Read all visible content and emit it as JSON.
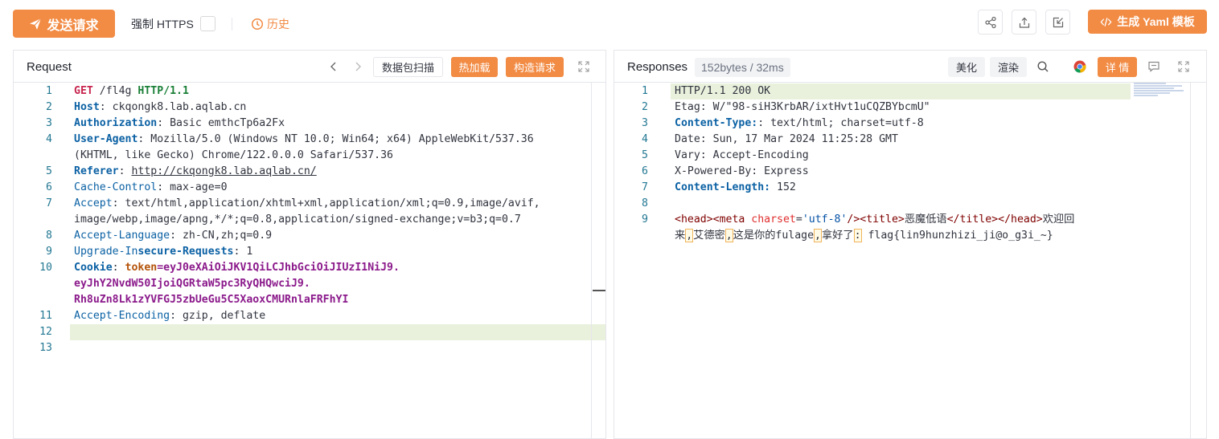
{
  "toolbar": {
    "send_label": "发送请求",
    "force_https_label": "强制 HTTPS",
    "force_https_checked": false,
    "history_label": "历史",
    "generate_label": "生成 Yaml 模板",
    "accent_color": "#f28b44"
  },
  "request": {
    "title": "Request",
    "buttons": {
      "scan": "数据包扫描",
      "hot_load": "热加载",
      "build": "构造请求"
    },
    "lines": [
      {
        "n": "1",
        "parts": [
          [
            "kw-method",
            "GET"
          ],
          [
            "kw-path",
            " /fl4g "
          ],
          [
            "kw-proto",
            "HTTP/1.1"
          ]
        ]
      },
      {
        "n": "2",
        "parts": [
          [
            "kw-key",
            "Host"
          ],
          [
            "",
            ": ckqongk8.lab.aqlab.cn"
          ]
        ]
      },
      {
        "n": "3",
        "parts": [
          [
            "kw-key",
            "Authorization"
          ],
          [
            "",
            ": Basic emthcTp6a2Fx"
          ]
        ]
      },
      {
        "n": "4",
        "parts": [
          [
            "kw-key",
            "User-Agent"
          ],
          [
            "",
            ": Mozilla/5.0 (Windows NT 10.0; Win64; x64) AppleWebKit/537.36"
          ]
        ]
      },
      {
        "n": "",
        "parts": [
          [
            "",
            "(KHTML, like Gecko) Chrome/122.0.0.0 Safari/537.36"
          ]
        ]
      },
      {
        "n": "5",
        "parts": [
          [
            "kw-key",
            "Referer"
          ],
          [
            "",
            ": "
          ],
          [
            "kw-url",
            "http://ckqongk8.lab.aqlab.cn/"
          ]
        ]
      },
      {
        "n": "6",
        "parts": [
          [
            "kw-key2",
            "Cache-Control"
          ],
          [
            "",
            ": max-age=0"
          ]
        ]
      },
      {
        "n": "7",
        "parts": [
          [
            "kw-key2",
            "Accept"
          ],
          [
            "",
            ": text/html,application/xhtml+xml,application/xml;q=0.9,image/avif,"
          ]
        ]
      },
      {
        "n": "",
        "parts": [
          [
            "",
            "image/webp,image/apng,*/*;q=0.8,application/signed-exchange;v=b3;q=0.7"
          ]
        ]
      },
      {
        "n": "8",
        "parts": [
          [
            "kw-key2",
            "Accept-Language"
          ],
          [
            "",
            ": zh-CN,zh;q=0.9"
          ]
        ]
      },
      {
        "n": "9",
        "parts": [
          [
            "kw-key2",
            "Upgrade-In"
          ],
          [
            "kw-key",
            "secure-Requests"
          ],
          [
            "",
            ": 1"
          ]
        ]
      },
      {
        "n": "10",
        "parts": [
          [
            "kw-key",
            "Cookie"
          ],
          [
            "",
            ": "
          ],
          [
            "kw-ck",
            "token"
          ],
          [
            "kw-cookie",
            "=eyJ0eXAiOiJKV1QiLCJhbGciOiJIUzI1NiJ9."
          ]
        ]
      },
      {
        "n": "",
        "parts": [
          [
            "kw-cookie",
            "eyJhY2NvdW50IjoiQGRtaW5pc3RyQHQwciJ9."
          ]
        ]
      },
      {
        "n": "",
        "parts": [
          [
            "kw-cookie",
            "Rh8uZn8Lk1zYVFGJ5zbUeGu5C5XaoxCMURnlaFRFhYI"
          ]
        ]
      },
      {
        "n": "11",
        "parts": [
          [
            "kw-key2",
            "Accept-Encoding"
          ],
          [
            "",
            ": gzip, deflate"
          ]
        ]
      },
      {
        "n": "12",
        "parts": [
          [
            "",
            ""
          ]
        ]
      },
      {
        "n": "13",
        "parts": [
          [
            "",
            ""
          ]
        ]
      }
    ]
  },
  "response": {
    "title": "Responses",
    "size_info": "152bytes / 32ms",
    "buttons": {
      "beautify": "美化",
      "render": "渲染",
      "details": "详 情"
    },
    "lines": [
      {
        "n": "1",
        "parts": [
          [
            "",
            "HTTP/1.1 200 OK"
          ]
        ]
      },
      {
        "n": "2",
        "parts": [
          [
            "",
            "Etag: W/\"98-siH3KrbAR/ixtHvt1uCQZBYbcmU\""
          ]
        ]
      },
      {
        "n": "3",
        "parts": [
          [
            "kw-key",
            "Content-Type:"
          ],
          [
            "",
            ": text/html; charset=utf-8"
          ]
        ]
      },
      {
        "n": "4",
        "parts": [
          [
            "",
            "Date: Sun, 17 Mar 2024 11:25:28 GMT"
          ]
        ]
      },
      {
        "n": "5",
        "parts": [
          [
            "",
            "Vary: Accept-Encoding"
          ]
        ]
      },
      {
        "n": "6",
        "parts": [
          [
            "",
            "X-Powered-By: Express"
          ]
        ]
      },
      {
        "n": "7",
        "parts": [
          [
            "kw-key",
            "Content-Length:"
          ],
          [
            "",
            " 152"
          ]
        ]
      },
      {
        "n": "8",
        "parts": [
          [
            "",
            ""
          ]
        ]
      },
      {
        "n": "9",
        "parts": [
          [
            "tag",
            "<head><meta "
          ],
          [
            "attr",
            "charset"
          ],
          [
            "",
            "="
          ],
          [
            "attrv",
            "'utf-8'"
          ],
          [
            "tag",
            "/><title>"
          ],
          [
            "",
            "恶魔低语"
          ],
          [
            "tag",
            "</title></head>"
          ],
          [
            "",
            "欢迎回"
          ]
        ]
      },
      {
        "n": "",
        "parts": [
          [
            "",
            "来"
          ],
          [
            "punct",
            ","
          ],
          [
            "",
            "艾德密"
          ],
          [
            "punct",
            ","
          ],
          [
            "",
            "这是你的fulage"
          ],
          [
            "punct",
            ","
          ],
          [
            "",
            "拿好了"
          ],
          [
            "punct",
            ":"
          ],
          [
            "",
            " flag{lin9hunzhizi_ji@o_g3i_~}"
          ]
        ]
      }
    ]
  }
}
